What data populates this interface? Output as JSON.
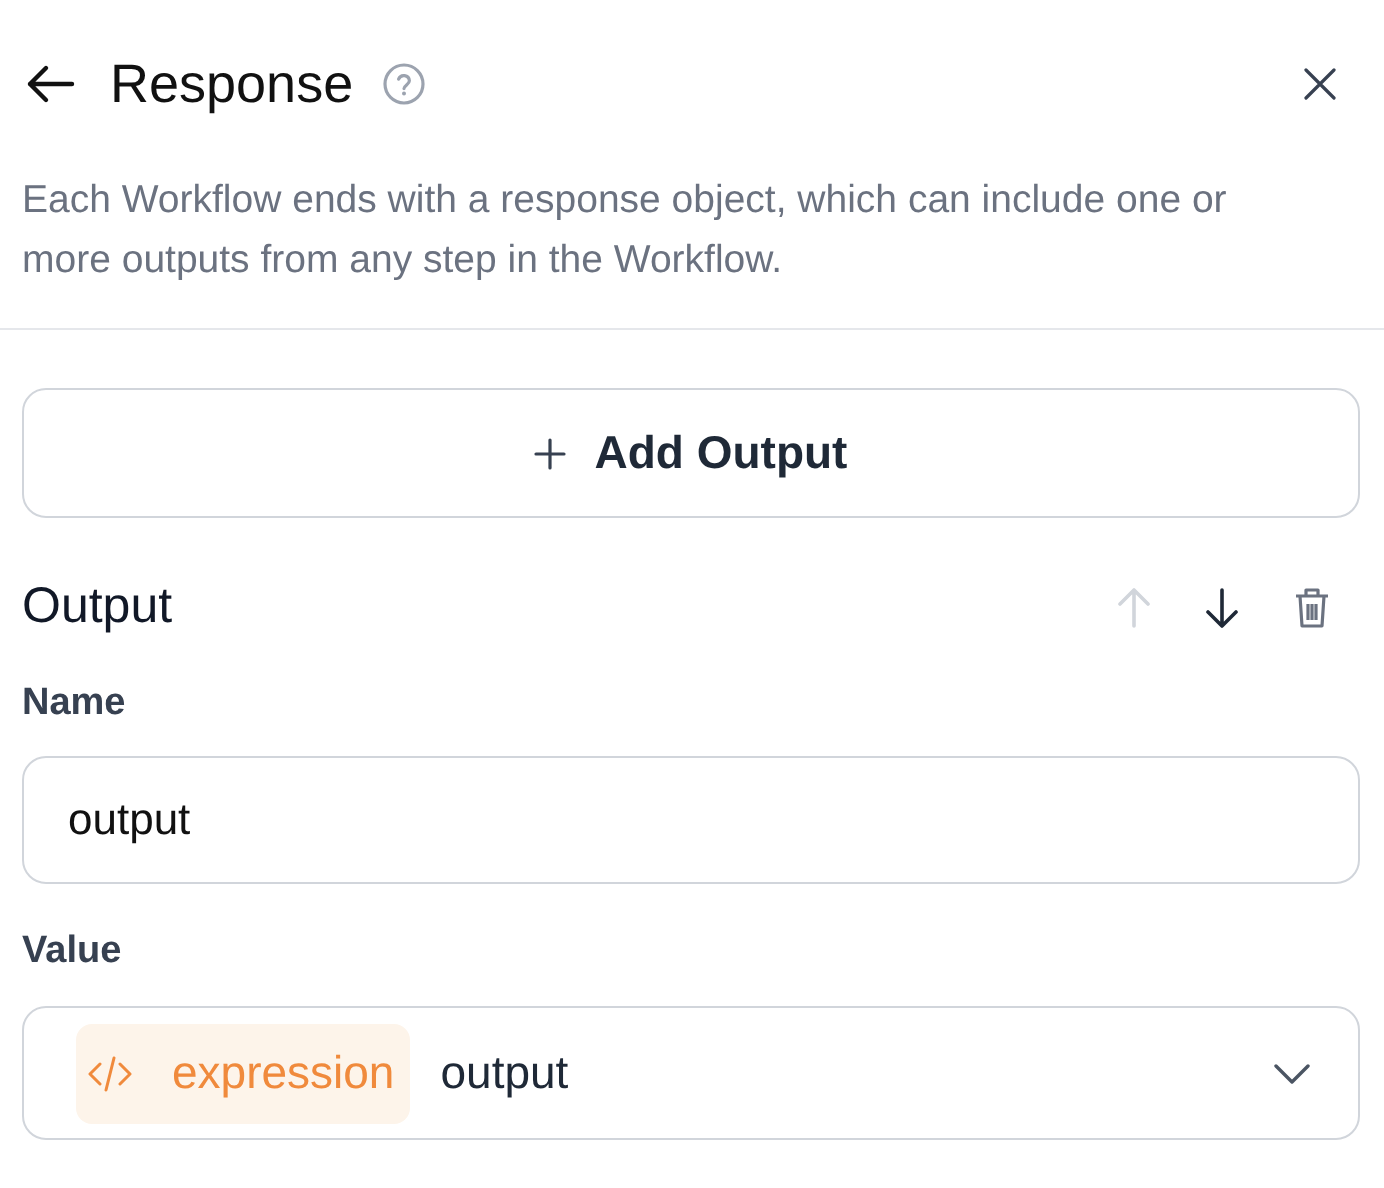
{
  "header": {
    "title": "Response"
  },
  "description": "Each Workflow ends with a response object, which can include one or more outputs from any step in the Workflow.",
  "add_button": {
    "label": "Add Output"
  },
  "output": {
    "title": "Output",
    "actions": [
      {
        "kind": "up",
        "disabled": true
      },
      {
        "kind": "down",
        "disabled": false
      },
      {
        "kind": "delete",
        "disabled": false
      }
    ],
    "name_field": {
      "label": "Name",
      "value": "output"
    },
    "value_field": {
      "label": "Value",
      "tag": "expression",
      "value": "output"
    }
  }
}
